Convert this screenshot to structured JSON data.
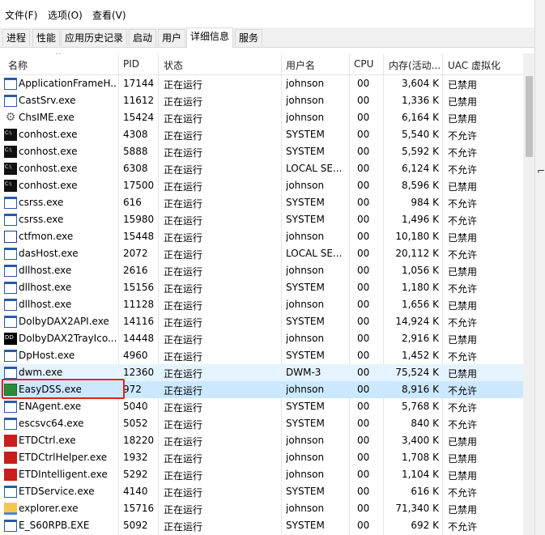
{
  "menu": [
    "文件(F)",
    "选项(O)",
    "查看(V)"
  ],
  "tabs": [
    "进程",
    "性能",
    "应用历史记录",
    "启动",
    "用户",
    "详细信息",
    "服务"
  ],
  "active_tab": "详细信息",
  "columns": [
    "名称",
    "PID",
    "状态",
    "用户名",
    "CPU",
    "内存(活动...",
    "UAC 虚拟化"
  ],
  "rows": [
    {
      "icon": "window-frame-icon",
      "name": "ApplicationFrameH...",
      "pid": "17144",
      "status": "正在运行",
      "user": "johnson",
      "cpu": "00",
      "mem": "3,604 K",
      "uac": "已禁用"
    },
    {
      "icon": "window-frame-icon",
      "name": "CastSrv.exe",
      "pid": "11612",
      "status": "正在运行",
      "user": "johnson",
      "cpu": "00",
      "mem": "1,336 K",
      "uac": "已禁用"
    },
    {
      "icon": "gear-icon",
      "name": "ChsIME.exe",
      "pid": "15424",
      "status": "正在运行",
      "user": "johnson",
      "cpu": "00",
      "mem": "6,164 K",
      "uac": "已禁用"
    },
    {
      "icon": "console-icon",
      "name": "conhost.exe",
      "pid": "4308",
      "status": "正在运行",
      "user": "SYSTEM",
      "cpu": "00",
      "mem": "5,540 K",
      "uac": "不允许"
    },
    {
      "icon": "console-icon",
      "name": "conhost.exe",
      "pid": "5888",
      "status": "正在运行",
      "user": "SYSTEM",
      "cpu": "00",
      "mem": "5,592 K",
      "uac": "不允许"
    },
    {
      "icon": "console-icon",
      "name": "conhost.exe",
      "pid": "6308",
      "status": "正在运行",
      "user": "LOCAL SE...",
      "cpu": "00",
      "mem": "6,124 K",
      "uac": "不允许"
    },
    {
      "icon": "console-icon",
      "name": "conhost.exe",
      "pid": "17500",
      "status": "正在运行",
      "user": "johnson",
      "cpu": "00",
      "mem": "8,596 K",
      "uac": "已禁用"
    },
    {
      "icon": "window-frame-icon",
      "name": "csrss.exe",
      "pid": "616",
      "status": "正在运行",
      "user": "SYSTEM",
      "cpu": "00",
      "mem": "984 K",
      "uac": "不允许"
    },
    {
      "icon": "window-frame-icon",
      "name": "csrss.exe",
      "pid": "15980",
      "status": "正在运行",
      "user": "SYSTEM",
      "cpu": "00",
      "mem": "1,496 K",
      "uac": "不允许"
    },
    {
      "icon": "pencil-icon",
      "name": "ctfmon.exe",
      "pid": "15448",
      "status": "正在运行",
      "user": "johnson",
      "cpu": "00",
      "mem": "10,180 K",
      "uac": "已禁用"
    },
    {
      "icon": "window-frame-icon",
      "name": "dasHost.exe",
      "pid": "2072",
      "status": "正在运行",
      "user": "LOCAL SE...",
      "cpu": "00",
      "mem": "20,112 K",
      "uac": "不允许"
    },
    {
      "icon": "window-frame-icon",
      "name": "dllhost.exe",
      "pid": "2616",
      "status": "正在运行",
      "user": "johnson",
      "cpu": "00",
      "mem": "1,056 K",
      "uac": "已禁用"
    },
    {
      "icon": "window-frame-icon",
      "name": "dllhost.exe",
      "pid": "15156",
      "status": "正在运行",
      "user": "SYSTEM",
      "cpu": "00",
      "mem": "1,180 K",
      "uac": "不允许"
    },
    {
      "icon": "window-frame-icon",
      "name": "dllhost.exe",
      "pid": "11128",
      "status": "正在运行",
      "user": "johnson",
      "cpu": "00",
      "mem": "1,656 K",
      "uac": "已禁用"
    },
    {
      "icon": "window-frame-icon",
      "name": "DolbyDAX2API.exe",
      "pid": "14116",
      "status": "正在运行",
      "user": "SYSTEM",
      "cpu": "00",
      "mem": "14,924 K",
      "uac": "不允许"
    },
    {
      "icon": "dolby-icon",
      "name": "DolbyDAX2TrayIco...",
      "pid": "14448",
      "status": "正在运行",
      "user": "johnson",
      "cpu": "00",
      "mem": "2,916 K",
      "uac": "已禁用"
    },
    {
      "icon": "window-frame-icon",
      "name": "DpHost.exe",
      "pid": "4960",
      "status": "正在运行",
      "user": "SYSTEM",
      "cpu": "00",
      "mem": "1,452 K",
      "uac": "不允许"
    },
    {
      "icon": "window-frame-icon",
      "name": "dwm.exe",
      "pid": "12360",
      "status": "正在运行",
      "user": "DWM-3",
      "cpu": "00",
      "mem": "75,524 K",
      "uac": "已禁用"
    },
    {
      "icon": "easydss-icon",
      "name": "EasyDSS.exe",
      "pid": "972",
      "status": "正在运行",
      "user": "johnson",
      "cpu": "00",
      "mem": "8,916 K",
      "uac": "不允许"
    },
    {
      "icon": "window-frame-icon",
      "name": "ENAgent.exe",
      "pid": "5040",
      "status": "正在运行",
      "user": "SYSTEM",
      "cpu": "00",
      "mem": "5,768 K",
      "uac": "不允许"
    },
    {
      "icon": "window-rect-icon",
      "name": "escsvc64.exe",
      "pid": "5052",
      "status": "正在运行",
      "user": "SYSTEM",
      "cpu": "00",
      "mem": "840 K",
      "uac": "不允许"
    },
    {
      "icon": "red-app-icon",
      "name": "ETDCtrl.exe",
      "pid": "18220",
      "status": "正在运行",
      "user": "johnson",
      "cpu": "00",
      "mem": "3,400 K",
      "uac": "已禁用"
    },
    {
      "icon": "red-app-icon",
      "name": "ETDCtrlHelper.exe",
      "pid": "1932",
      "status": "正在运行",
      "user": "johnson",
      "cpu": "00",
      "mem": "1,708 K",
      "uac": "已禁用"
    },
    {
      "icon": "red-app-icon",
      "name": "ETDIntelligent.exe",
      "pid": "5292",
      "status": "正在运行",
      "user": "johnson",
      "cpu": "00",
      "mem": "1,104 K",
      "uac": "已禁用"
    },
    {
      "icon": "window-frame-icon",
      "name": "ETDService.exe",
      "pid": "4140",
      "status": "正在运行",
      "user": "SYSTEM",
      "cpu": "00",
      "mem": "616 K",
      "uac": "不允许"
    },
    {
      "icon": "folder-icon",
      "name": "explorer.exe",
      "pid": "15716",
      "status": "正在运行",
      "user": "johnson",
      "cpu": "00",
      "mem": "71,340 K",
      "uac": "已禁用"
    },
    {
      "icon": "window-frame-icon",
      "name": "E_S60RPB.EXE",
      "pid": "5092",
      "status": "正在运行",
      "user": "SYSTEM",
      "cpu": "00",
      "mem": "692 K",
      "uac": "不允许"
    }
  ],
  "selected_row": "EasyDSS.exe",
  "hover_row": "dwm.exe",
  "colors": {
    "selection": "#cce8ff",
    "hover": "#e5f3ff",
    "annotation_box": "#e02020"
  }
}
